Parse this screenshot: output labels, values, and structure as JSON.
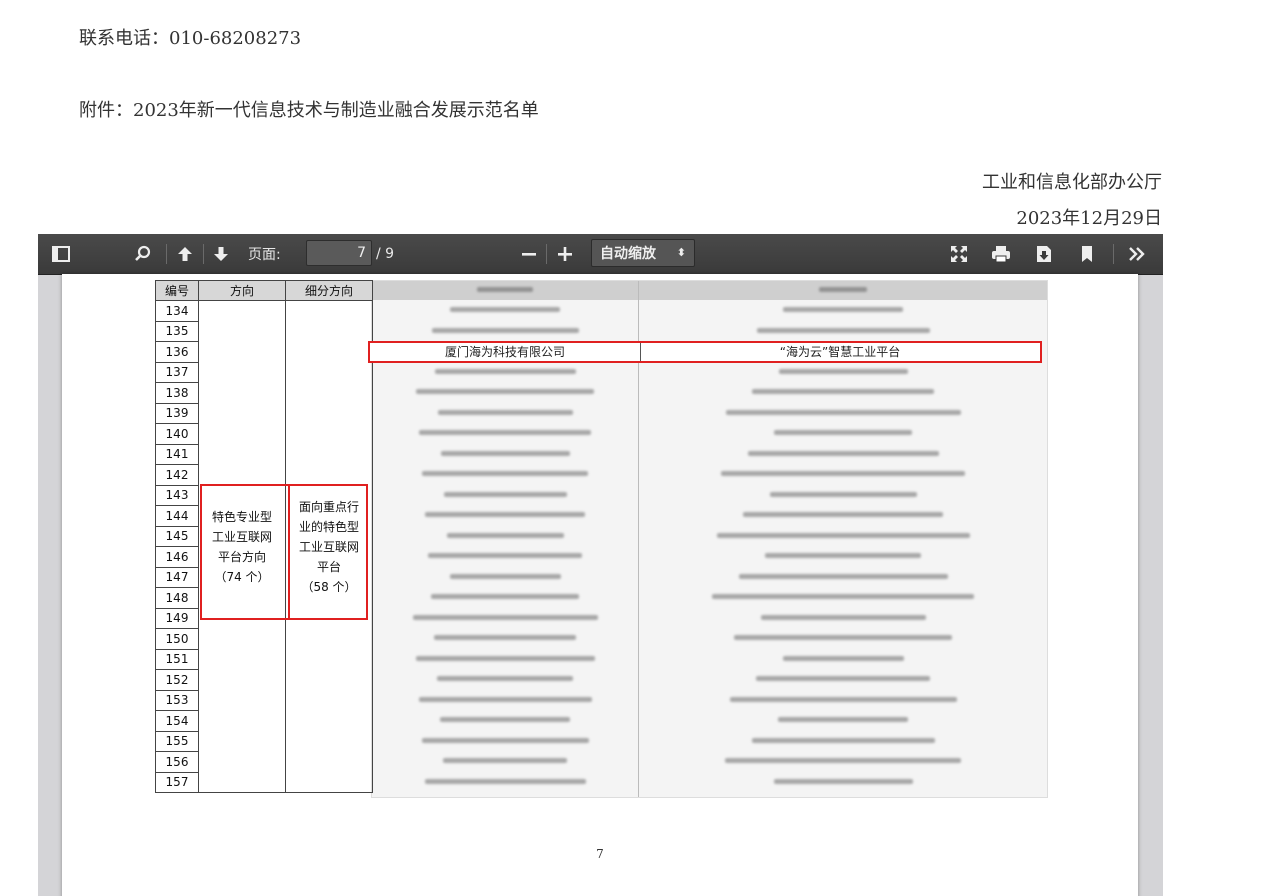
{
  "document": {
    "contact": "联系电话：010-68208273",
    "attachment": "附件：2023年新一代信息技术与制造业融合发展示范名单",
    "org": "工业和信息化部办公厅",
    "date": "2023年12月29日"
  },
  "toolbar": {
    "page_label": "页面:",
    "page_value": "7",
    "page_total": "/ 9",
    "zoom_value": "自动缩放"
  },
  "table": {
    "headers": [
      "编号",
      "方向",
      "细分方向"
    ],
    "rows": [
      "134",
      "135",
      "136",
      "137",
      "138",
      "139",
      "140",
      "141",
      "142",
      "143",
      "144",
      "145",
      "146",
      "147",
      "148",
      "149",
      "150",
      "151",
      "152",
      "153",
      "154",
      "155",
      "156",
      "157"
    ],
    "direction_text": [
      "特色专业型",
      "工业互联网",
      "平台方向",
      "（74 个）"
    ],
    "sub_direction_text": [
      "面向重点行",
      "业的特色型",
      "工业互联网",
      "平台",
      "（58 个）"
    ],
    "highlight_row": {
      "company": "厦门海为科技有限公司",
      "project": "“海为云”智慧工业平台"
    }
  },
  "page_number": "7"
}
